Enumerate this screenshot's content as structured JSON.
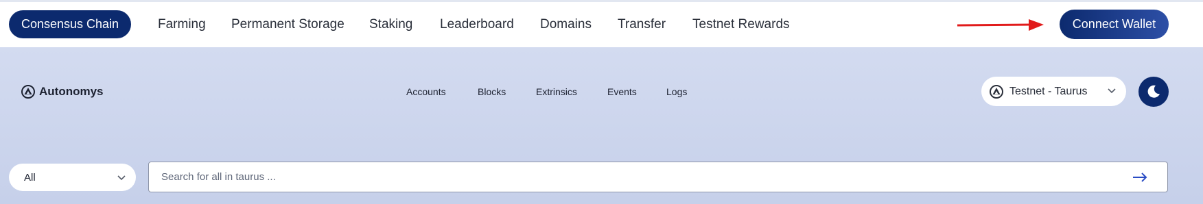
{
  "top_nav": {
    "active": "Consensus Chain",
    "links": [
      "Farming",
      "Permanent Storage",
      "Staking",
      "Leaderboard",
      "Domains",
      "Transfer",
      "Testnet Rewards"
    ],
    "connect_wallet": "Connect Wallet"
  },
  "explorer": {
    "brand": "Autonomys",
    "links": [
      "Accounts",
      "Blocks",
      "Extrinsics",
      "Events",
      "Logs"
    ],
    "network_selector": "Testnet - Taurus"
  },
  "search": {
    "filter_value": "All",
    "placeholder": "Search for all in taurus ..."
  },
  "colors": {
    "primary": "#0c2a6e",
    "annotation_arrow": "#e11b1b",
    "background": "#cdd6ee"
  }
}
